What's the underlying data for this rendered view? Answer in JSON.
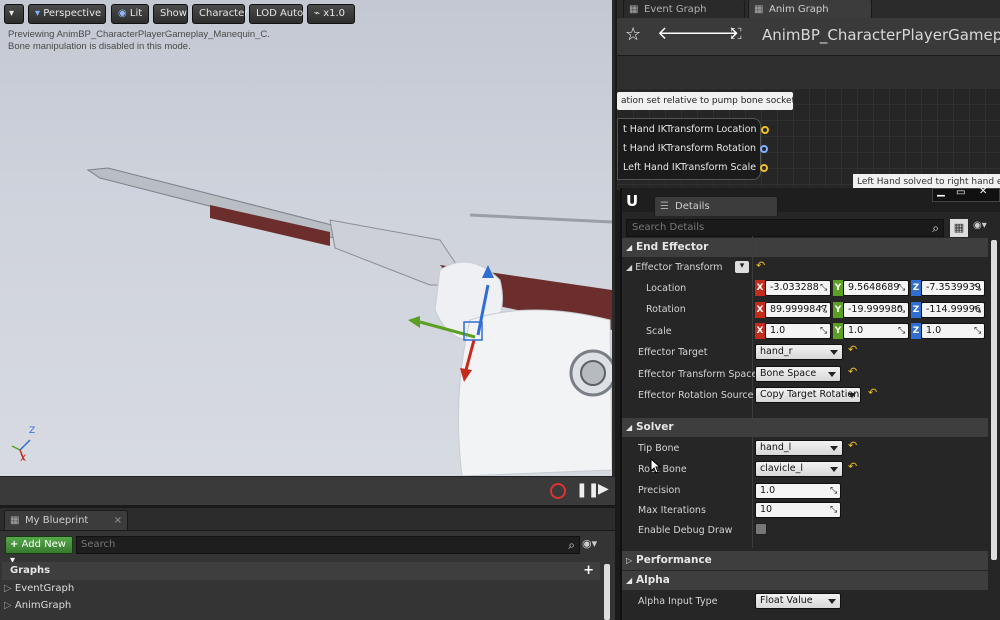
{
  "viewport": {
    "toolbar": {
      "perspective": "Perspective",
      "lit": "Lit",
      "show": "Show",
      "character": "Character",
      "lod": "LOD Auto",
      "speed": "x1.0"
    },
    "message_line1": "Previewing AnimBP_CharacterPlayerGameplay_Manequin_C.",
    "message_line2": "Bone manipulation is disabled in this mode.",
    "axis_z": "Z",
    "axis_x": "X"
  },
  "my_blueprint": {
    "tab_label": "My Blueprint",
    "add_new_label": "Add New",
    "search_placeholder": "Search",
    "graphs_header": "Graphs",
    "graph_items": [
      "EventGraph",
      "AnimGraph"
    ]
  },
  "graph_editor": {
    "tabs": [
      "Event Graph",
      "Anim Graph"
    ],
    "title": "AnimBP_CharacterPlayerGameplay",
    "comment_text": "ation set relative to pump bone socket",
    "pins": [
      "t Hand IKTransform Location",
      "t Hand IKTransform Rotation",
      "Left Hand IKTransform Scale"
    ],
    "comment_right": "Left Hand solved to right hand eff"
  },
  "details": {
    "tab_label": "Details",
    "search_placeholder": "Search Details",
    "end_effector": {
      "header": "End Effector",
      "effector_transform_label": "Effector Transform",
      "location_label": "Location",
      "location": [
        "-3.033288",
        "9.5648689",
        "-7.3539939"
      ],
      "rotation_label": "Rotation",
      "rotation": [
        "89.9999847",
        "-19.999980",
        "-114.99996"
      ],
      "scale_label": "Scale",
      "scale": [
        "1.0",
        "1.0",
        "1.0"
      ],
      "effector_target_label": "Effector Target",
      "effector_target": "hand_r",
      "transform_space_label": "Effector Transform Space",
      "transform_space": "Bone Space",
      "rotation_source_label": "Effector Rotation Source",
      "rotation_source": "Copy Target Rotation"
    },
    "solver": {
      "header": "Solver",
      "tip_bone_label": "Tip Bone",
      "tip_bone": "hand_l",
      "root_bone_label": "Root Bone",
      "root_bone": "clavicle_l",
      "precision_label": "Precision",
      "precision": "1.0",
      "max_iterations_label": "Max Iterations",
      "max_iterations": "10",
      "debug_draw_label": "Enable Debug Draw"
    },
    "performance_header": "Performance",
    "alpha": {
      "header": "Alpha",
      "alpha_input_type_label": "Alpha Input Type",
      "alpha_input_type": "Float Value"
    }
  },
  "colors": {
    "axis_x": "#c42b1c",
    "axis_y": "#5ba022",
    "axis_z": "#2f6ed3",
    "accent_green": "#4b9a2e",
    "pin_yellow": "#f0c020"
  }
}
